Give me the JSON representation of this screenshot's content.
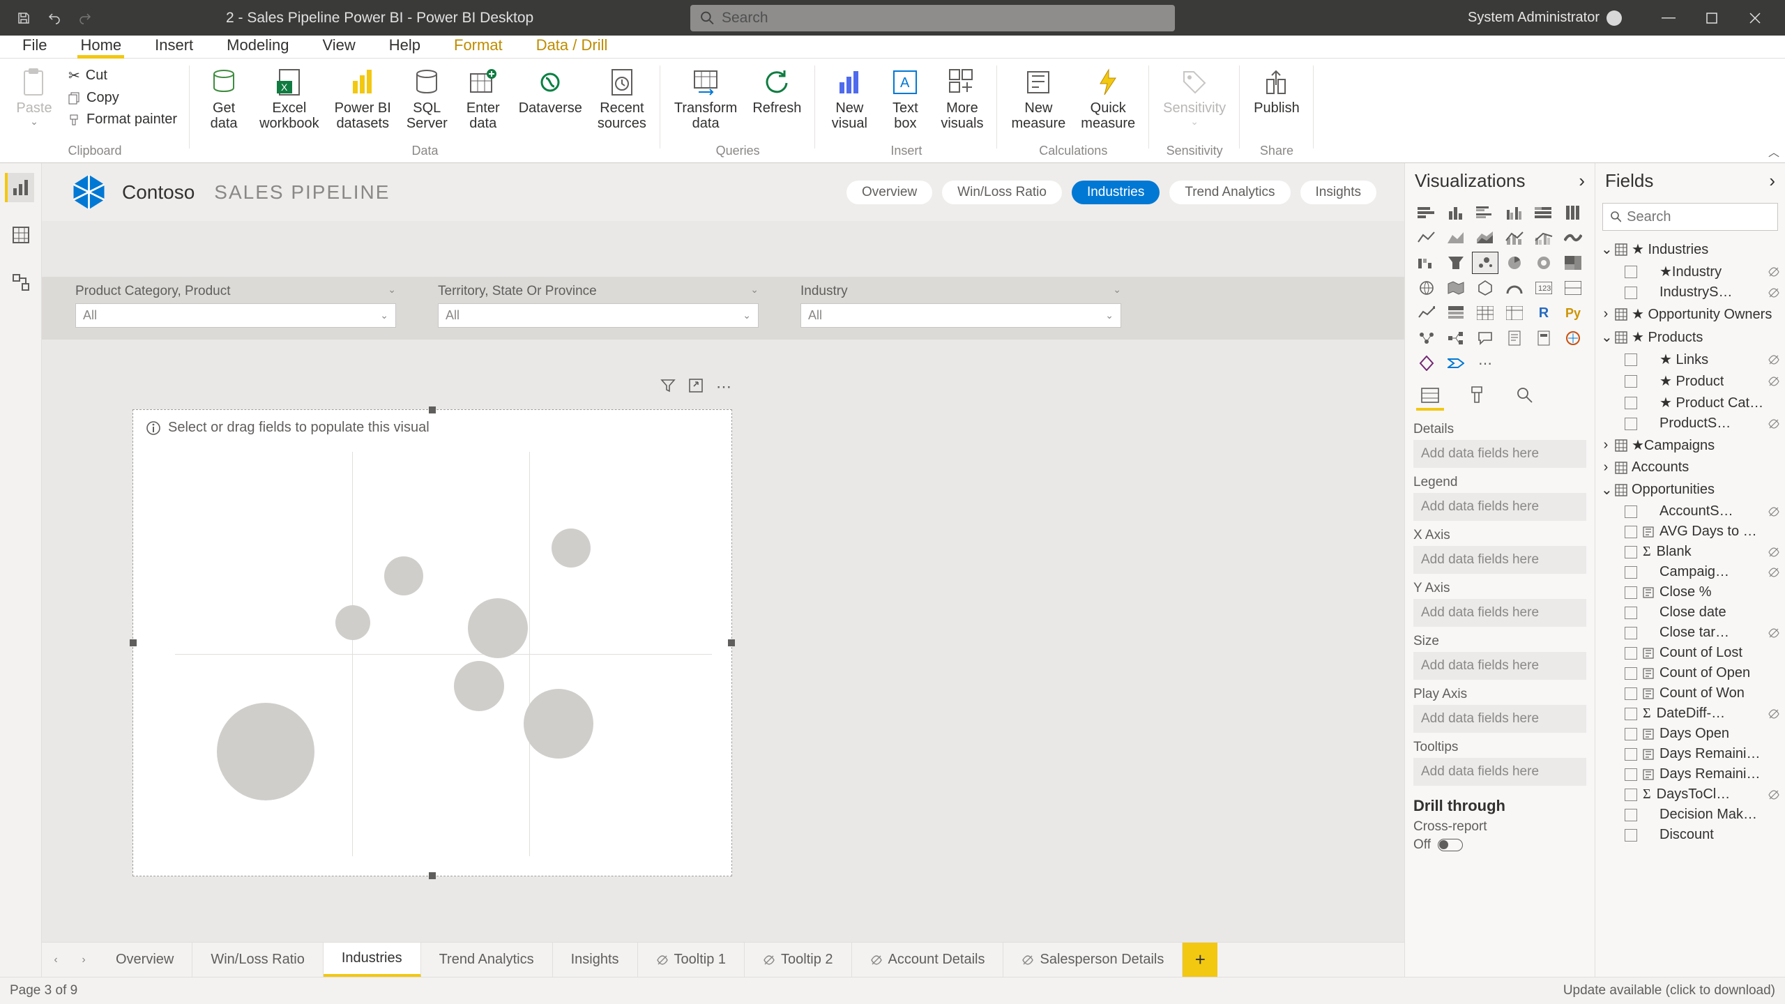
{
  "titlebar": {
    "doc_title": "2 - Sales Pipeline Power BI - Power BI Desktop",
    "search_placeholder": "Search",
    "user_name": "System Administrator"
  },
  "menu": {
    "tabs": [
      "File",
      "Home",
      "Insert",
      "Modeling",
      "View",
      "Help",
      "Format",
      "Data / Drill"
    ],
    "active": "Home"
  },
  "ribbon": {
    "clipboard": {
      "label": "Clipboard",
      "paste": "Paste",
      "cut": "Cut",
      "copy": "Copy",
      "format_painter": "Format painter"
    },
    "data": {
      "label": "Data",
      "get": "Get\ndata",
      "excel": "Excel\nworkbook",
      "pbids": "Power BI\ndatasets",
      "sql": "SQL\nServer",
      "enter": "Enter\ndata",
      "dataverse": "Dataverse",
      "recent": "Recent\nsources"
    },
    "queries": {
      "label": "Queries",
      "transform": "Transform\ndata",
      "refresh": "Refresh"
    },
    "insert": {
      "label": "Insert",
      "newvisual": "New\nvisual",
      "textbox": "Text\nbox",
      "more": "More\nvisuals"
    },
    "calc": {
      "label": "Calculations",
      "measure": "New\nmeasure",
      "quick": "Quick\nmeasure"
    },
    "sens": {
      "label": "Sensitivity",
      "btn": "Sensitivity"
    },
    "share": {
      "label": "Share",
      "publish": "Publish"
    }
  },
  "report": {
    "brand": "Contoso",
    "title": "SALES PIPELINE",
    "nav": [
      "Overview",
      "Win/Loss Ratio",
      "Industries",
      "Trend Analytics",
      "Insights"
    ],
    "nav_active": "Industries",
    "slicers": [
      {
        "title": "Product Category, Product",
        "value": "All"
      },
      {
        "title": "Territory, State Or Province",
        "value": "All"
      },
      {
        "title": "Industry",
        "value": "All"
      }
    ],
    "visual_hint": "Select or drag fields to populate this visual"
  },
  "viz_pane": {
    "title": "Visualizations",
    "wells": [
      "Details",
      "Legend",
      "X Axis",
      "Y Axis",
      "Size",
      "Play Axis",
      "Tooltips"
    ],
    "drop_placeholder": "Add data fields here",
    "drill_header": "Drill through",
    "cross_report": "Cross-report",
    "cross_report_state": "Off"
  },
  "fields_pane": {
    "title": "Fields",
    "search_placeholder": "Search",
    "tables": [
      {
        "name": "★ Industries",
        "expanded": true,
        "fields": [
          {
            "name": "★Industry",
            "hidden": true,
            "indent": true
          },
          {
            "name": "IndustryS…",
            "hidden": true
          }
        ]
      },
      {
        "name": "★ Opportunity Owners",
        "expanded": false
      },
      {
        "name": "★ Products",
        "expanded": true,
        "fields": [
          {
            "name": "★ Links",
            "hidden": true
          },
          {
            "name": "★ Product",
            "hidden": true
          },
          {
            "name": "★ Product Cate…"
          },
          {
            "name": "ProductS…",
            "hidden": true
          }
        ]
      },
      {
        "name": "★Campaigns",
        "expanded": false
      },
      {
        "name": "Accounts",
        "expanded": false
      },
      {
        "name": "Opportunities",
        "expanded": true,
        "fields": [
          {
            "name": "AccountS…",
            "hidden": true
          },
          {
            "name": "AVG Days to Cl…",
            "icon": "measure"
          },
          {
            "name": "Blank",
            "hidden": true,
            "icon": "sigma"
          },
          {
            "name": "Campaig…",
            "hidden": true
          },
          {
            "name": "Close %",
            "icon": "measure"
          },
          {
            "name": "Close date"
          },
          {
            "name": "Close tar…",
            "hidden": true
          },
          {
            "name": "Count of Lost",
            "icon": "measure"
          },
          {
            "name": "Count of Open",
            "icon": "measure"
          },
          {
            "name": "Count of Won",
            "icon": "measure"
          },
          {
            "name": "DateDiff-…",
            "hidden": true,
            "icon": "sigma"
          },
          {
            "name": "Days Open",
            "icon": "measure"
          },
          {
            "name": "Days Remainin…",
            "icon": "measure"
          },
          {
            "name": "Days Remainin…",
            "icon": "measure"
          },
          {
            "name": "DaysToCl…",
            "hidden": true,
            "icon": "sigma"
          },
          {
            "name": "Decision Maker…"
          },
          {
            "name": "Discount"
          }
        ]
      }
    ]
  },
  "page_tabs": {
    "tabs": [
      {
        "label": "Overview"
      },
      {
        "label": "Win/Loss Ratio"
      },
      {
        "label": "Industries",
        "active": true
      },
      {
        "label": "Trend Analytics"
      },
      {
        "label": "Insights"
      },
      {
        "label": "Tooltip 1",
        "hidden": true
      },
      {
        "label": "Tooltip 2",
        "hidden": true
      },
      {
        "label": "Account Details",
        "hidden": true
      },
      {
        "label": "Salesperson Details",
        "hidden": true
      }
    ]
  },
  "statusbar": {
    "page": "Page 3 of 9",
    "update": "Update available (click to download)"
  }
}
